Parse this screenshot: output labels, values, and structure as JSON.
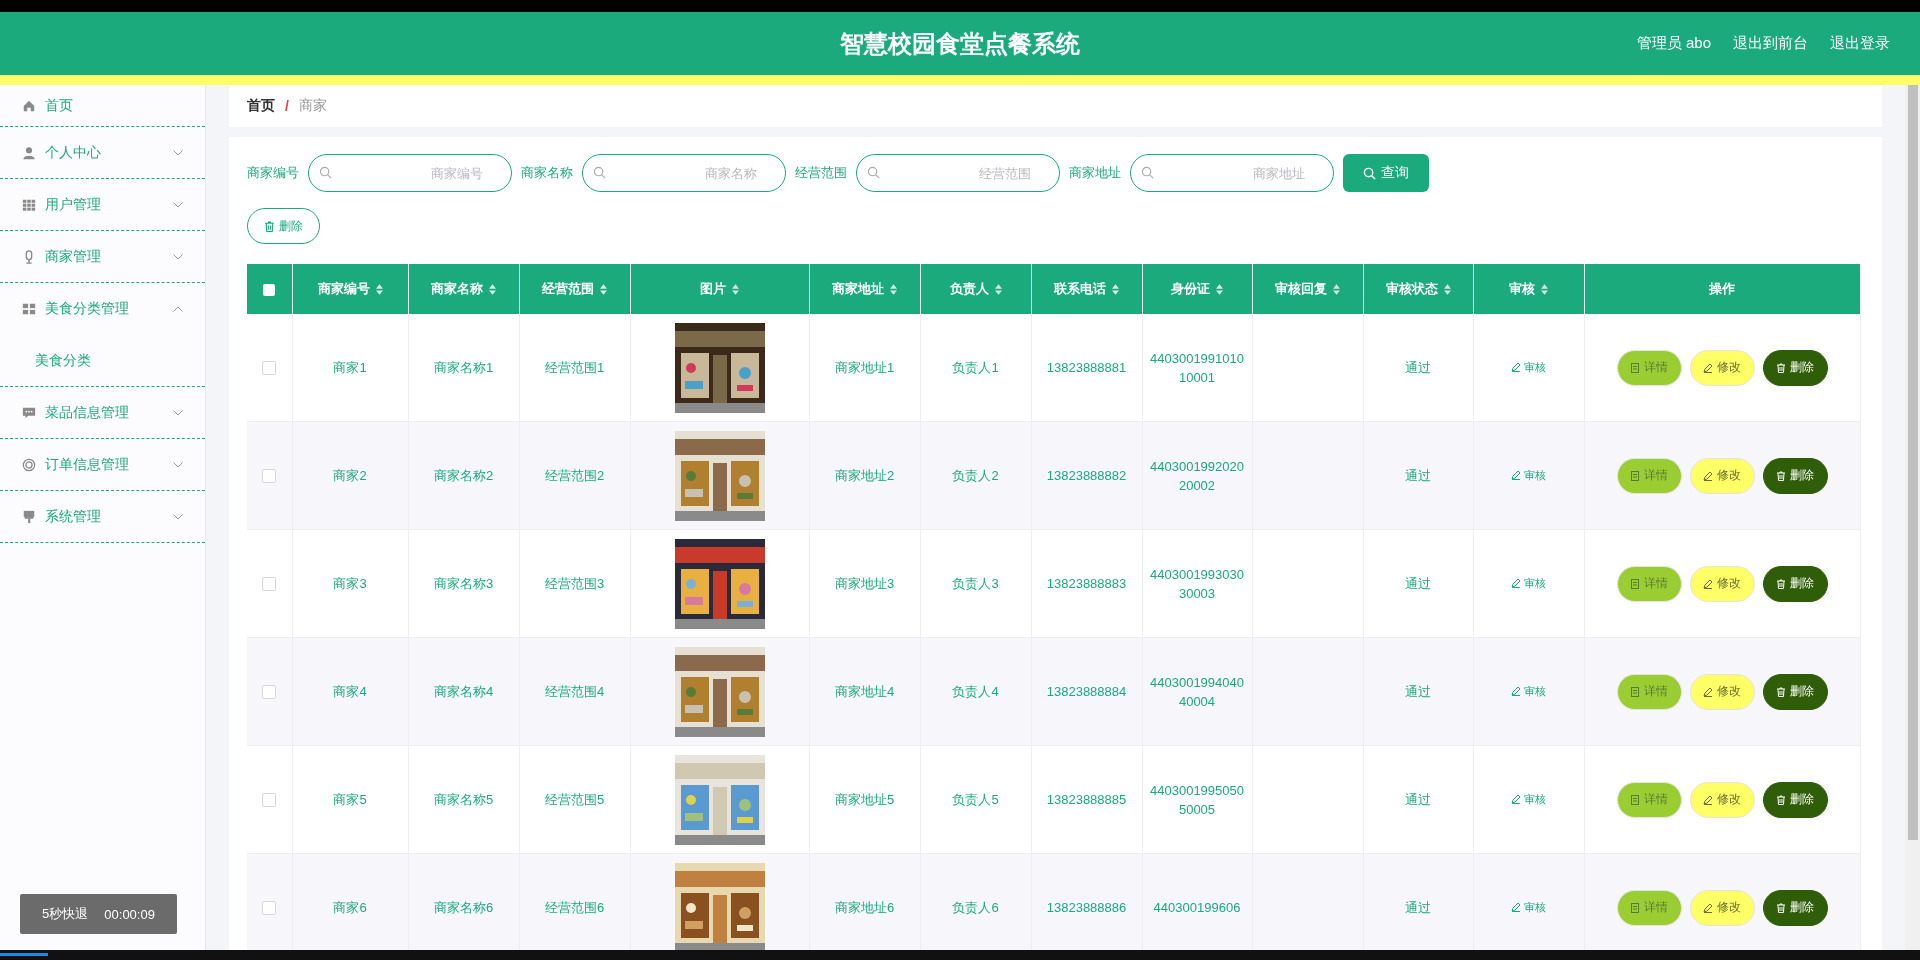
{
  "header": {
    "title": "智慧校园食堂点餐系统",
    "user": "管理员 abo",
    "links": [
      "退出到前台",
      "退出登录"
    ]
  },
  "sidebar": {
    "items": [
      {
        "label": "首页"
      },
      {
        "label": "个人中心",
        "expanded": false
      },
      {
        "label": "用户管理",
        "expanded": false
      },
      {
        "label": "商家管理",
        "expanded": false
      },
      {
        "label": "美食分类管理",
        "expanded": true,
        "children": [
          {
            "label": "美食分类"
          }
        ]
      },
      {
        "label": "菜品信息管理",
        "expanded": false
      },
      {
        "label": "订单信息管理",
        "expanded": false
      },
      {
        "label": "系统管理",
        "expanded": false
      }
    ]
  },
  "breadcrumb": {
    "items": [
      "首页",
      "商家"
    ],
    "separator": "/"
  },
  "search": {
    "fields": [
      {
        "label": "商家编号",
        "placeholder": "商家编号"
      },
      {
        "label": "商家名称",
        "placeholder": "商家名称"
      },
      {
        "label": "经营范围",
        "placeholder": "经营范围"
      },
      {
        "label": "商家地址",
        "placeholder": "商家地址"
      }
    ],
    "button": "查询"
  },
  "delete_button": "删除",
  "table": {
    "select_all": {
      "checked": false
    },
    "columns": [
      {
        "label": "商家编号",
        "sortable": true
      },
      {
        "label": "商家名称",
        "sortable": true
      },
      {
        "label": "经营范围",
        "sortable": true
      },
      {
        "label": "图片",
        "sortable": true
      },
      {
        "label": "商家地址",
        "sortable": true
      },
      {
        "label": "负责人",
        "sortable": true
      },
      {
        "label": "联系电话",
        "sortable": true
      },
      {
        "label": "身份证",
        "sortable": true
      },
      {
        "label": "审核回复",
        "sortable": true
      },
      {
        "label": "审核状态",
        "sortable": true
      },
      {
        "label": "审核",
        "sortable": true
      },
      {
        "label": "操作",
        "sortable": false
      }
    ],
    "rows": [
      {
        "checked": false,
        "id": "商家1",
        "name": "商家名称1",
        "scope": "经营范围1",
        "image": {
          "kind": "picture"
        },
        "address": "商家地址1",
        "person": "负责人1",
        "phone": "13823888881",
        "id_card": "440300199101010001",
        "status": "通过",
        "review": "审核",
        "actions": [
          "详情",
          "修改",
          "删除"
        ]
      },
      {
        "checked": false,
        "id": "商家2",
        "name": "商家名称2",
        "scope": "经营范围2",
        "image": {
          "kind": "picture"
        },
        "address": "商家地址2",
        "person": "负责人2",
        "phone": "13823888882",
        "id_card": "440300199202020002",
        "status": "通过",
        "review": "审核",
        "actions": [
          "详情",
          "修改",
          "删除"
        ]
      },
      {
        "checked": false,
        "id": "商家3",
        "name": "商家名称3",
        "scope": "经营范围3",
        "image": {
          "kind": "picture"
        },
        "address": "商家地址3",
        "person": "负责人3",
        "phone": "13823888883",
        "id_card": "440300199303030003",
        "status": "通过",
        "review": "审核",
        "actions": [
          "详情",
          "修改",
          "删除"
        ]
      },
      {
        "checked": false,
        "id": "商家4",
        "name": "商家名称4",
        "scope": "经营范围4",
        "image": {
          "kind": "picture"
        },
        "address": "商家地址4",
        "person": "负责人4",
        "phone": "13823888884",
        "id_card": "440300199404040004",
        "status": "通过",
        "review": "审核",
        "actions": [
          "详情",
          "修改",
          "删除"
        ]
      },
      {
        "checked": false,
        "id": "商家5",
        "name": "商家名称5",
        "scope": "经营范围5",
        "image": {
          "kind": "picture"
        },
        "address": "商家地址5",
        "person": "负责人5",
        "phone": "13823888885",
        "id_card": "440300199505050005",
        "status": "通过",
        "review": "审核",
        "actions": [
          "详情",
          "修改",
          "删除"
        ]
      },
      {
        "checked": false,
        "id": "商家6",
        "name": "商家名称6",
        "scope": "经营范围6",
        "image": {
          "kind": "picture"
        },
        "address": "商家地址6",
        "person": "负责人6",
        "phone": "13823888886",
        "id_card": "440300199606",
        "status": "通过",
        "review": "审核",
        "actions": [
          "详情",
          "修改",
          "删除"
        ]
      }
    ]
  },
  "video": {
    "label": "5秒快退",
    "time": "00:00:09",
    "level": 0.025
  }
}
